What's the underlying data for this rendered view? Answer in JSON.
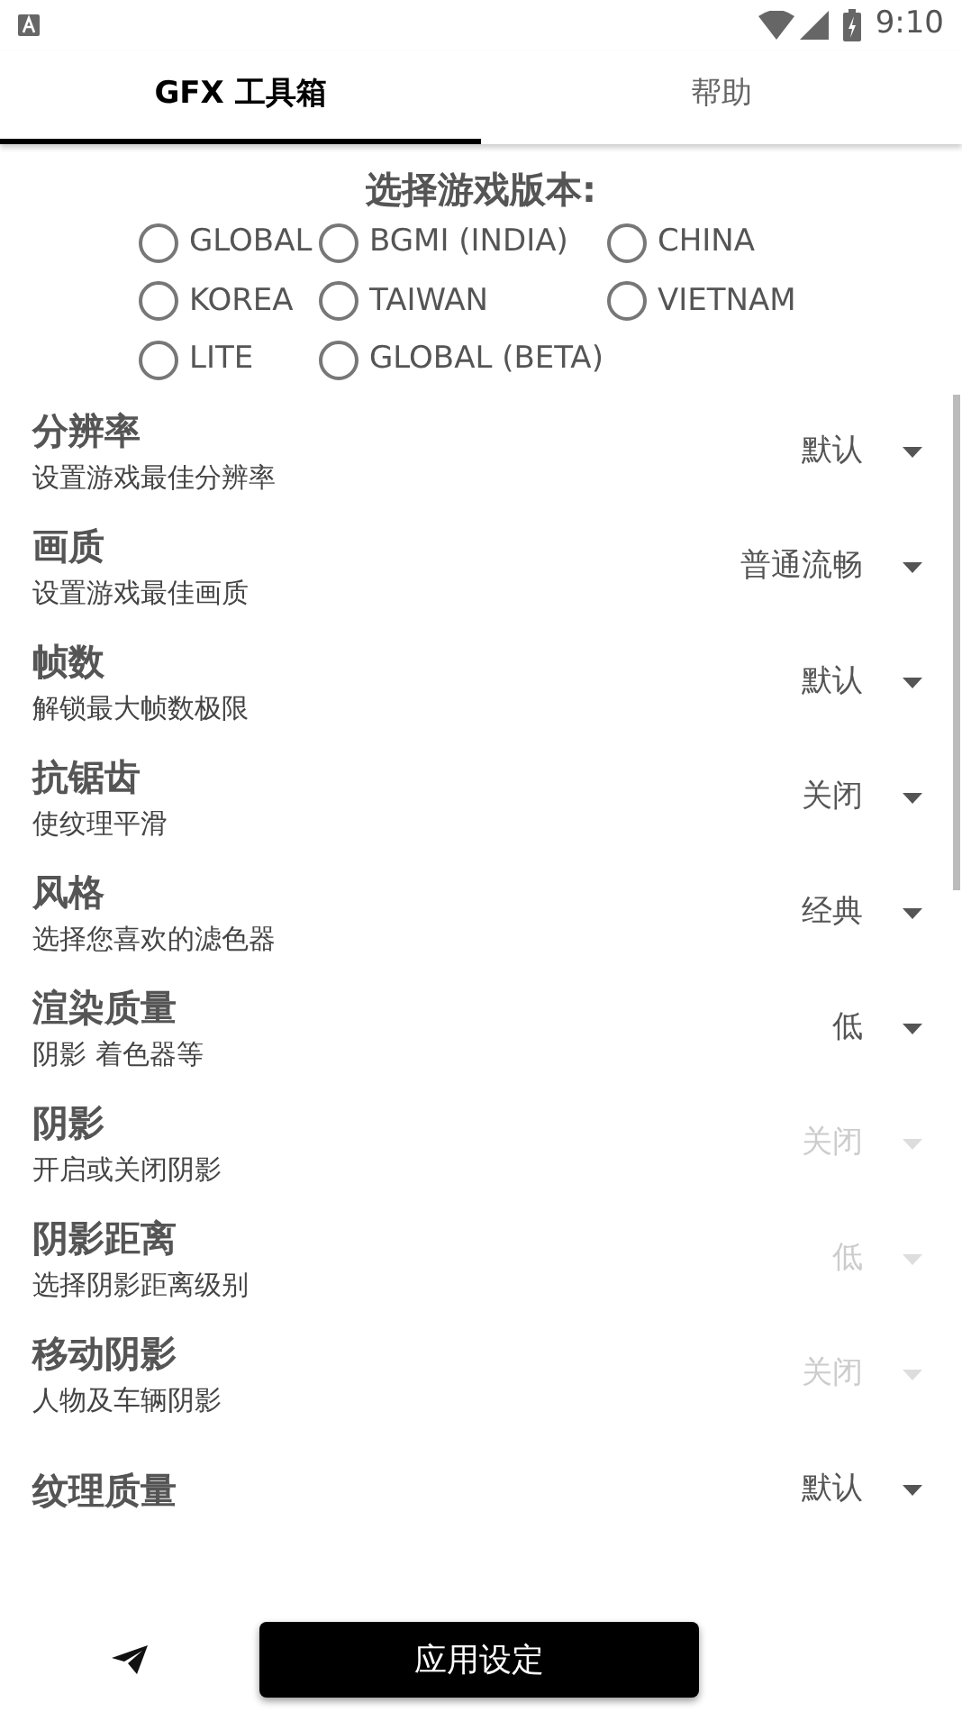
{
  "status_bar": {
    "time": "9:10"
  },
  "tabs": [
    {
      "label": "GFX 工具箱",
      "selected": true
    },
    {
      "label": "帮助",
      "selected": false
    }
  ],
  "version_heading": "选择游戏版本:",
  "versions": [
    [
      {
        "label": "GLOBAL",
        "selected": false
      },
      {
        "label": "BGMI (INDIA)",
        "selected": false
      },
      {
        "label": "CHINA",
        "selected": false
      }
    ],
    [
      {
        "label": "KOREA",
        "selected": false
      },
      {
        "label": "TAIWAN",
        "selected": false
      },
      {
        "label": "VIETNAM",
        "selected": false
      }
    ],
    [
      {
        "label": "LITE",
        "selected": false
      },
      {
        "label": "GLOBAL (BETA)",
        "selected": false
      }
    ]
  ],
  "settings": [
    {
      "title": "分辨率",
      "subtitle": "设置游戏最佳分辨率",
      "value": "默认",
      "disabled": false
    },
    {
      "title": "画质",
      "subtitle": "设置游戏最佳画质",
      "value": "普通流畅",
      "disabled": false
    },
    {
      "title": "帧数",
      "subtitle": "解锁最大帧数极限",
      "value": "默认",
      "disabled": false
    },
    {
      "title": "抗锯齿",
      "subtitle": "使纹理平滑",
      "value": "关闭",
      "disabled": false
    },
    {
      "title": "风格",
      "subtitle": "选择您喜欢的滤色器",
      "value": "经典",
      "disabled": false
    },
    {
      "title": "渲染质量",
      "subtitle": "阴影 着色器等",
      "value": "低",
      "disabled": false
    },
    {
      "title": "阴影",
      "subtitle": "开启或关闭阴影",
      "value": "关闭",
      "disabled": true
    },
    {
      "title": "阴影距离",
      "subtitle": "选择阴影距离级别",
      "value": "低",
      "disabled": true
    },
    {
      "title": "移动阴影",
      "subtitle": "人物及车辆阴影",
      "value": "关闭",
      "disabled": true
    },
    {
      "title": "纹理质量",
      "value": "默认",
      "disabled": false
    }
  ],
  "apply_button": "应用设定"
}
